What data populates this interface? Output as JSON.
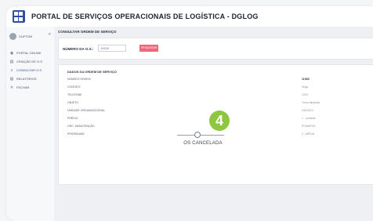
{
  "app": {
    "title": "PORTAL DE SERVIÇOS OPERACIONAIS DE LOGÍSTICA - DGLOG"
  },
  "sidebar": {
    "user_name": "CLIFTON",
    "collapse_glyph": "«",
    "items": [
      {
        "label": "PORTAL ONLINE",
        "icon": "globe-icon",
        "glyph": "◉"
      },
      {
        "label": "CRIAÇÃO DE O.S",
        "icon": "document-icon",
        "glyph": "▤"
      },
      {
        "label": "CONSULTAR O.S",
        "icon": "search-icon",
        "glyph": "⌕"
      },
      {
        "label": "RELATÓRIOS",
        "icon": "report-icon",
        "glyph": "▤"
      },
      {
        "label": "FECHAR",
        "icon": "close-icon",
        "glyph": "✕"
      }
    ],
    "active_index": 2
  },
  "main": {
    "section_title": "CONSULTAR ORDEM DE SERVIÇO",
    "search": {
      "label": "NÚMERO DA O.S.:",
      "value": "11935",
      "button_label": "PESQUISAR"
    },
    "details": {
      "title": "DADOS DA ORDEM DE SERVIÇO",
      "rows": [
        {
          "key": "NÚMERO ORDEM",
          "value": "11935"
        },
        {
          "key": "CONTATO",
          "value": "Hugo"
        },
        {
          "key": "TELEFONE",
          "value": "1234"
        },
        {
          "key": "OBJETO",
          "value": "Troca lâmpada"
        },
        {
          "key": "UNIDADE ORGANIZACIONAL",
          "value": "CIDGSCL"
        },
        {
          "key": "PRÉDIO",
          "value": "1 - unidade"
        },
        {
          "key": "ORC. MANUTENÇÃO",
          "value": "PCMAPOS"
        },
        {
          "key": "PRIORIDADE",
          "value": "2 - MÉDIA"
        }
      ]
    },
    "step_number": "4",
    "status": "OS CANCELADA"
  },
  "colors": {
    "brand": "#2f4fa0",
    "button": "#f0677d",
    "step_badge": "#8dc63f"
  }
}
